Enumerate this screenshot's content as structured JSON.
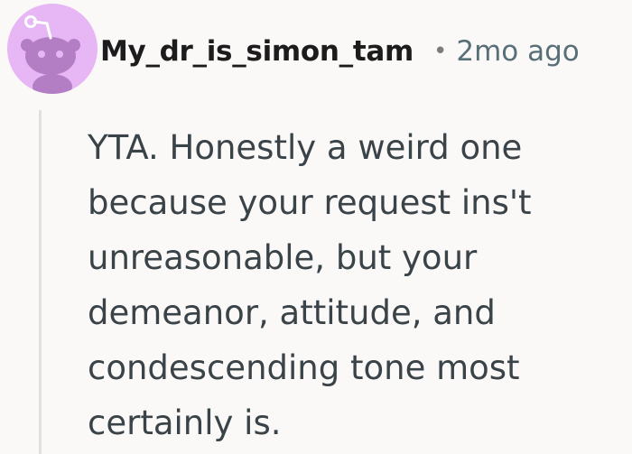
{
  "comment": {
    "author": "My_dr_is_simon_tam",
    "separator": "•",
    "timestamp": "2mo ago",
    "body": "YTA. Honestly a weird one because your request ins't unreasonable, but your demeanor, attitude, and condescending tone most certainly is."
  },
  "colors": {
    "avatar_background": "#e7b6f5",
    "page_background": "#fbf9f8",
    "thread_line": "#e5dfdc"
  }
}
